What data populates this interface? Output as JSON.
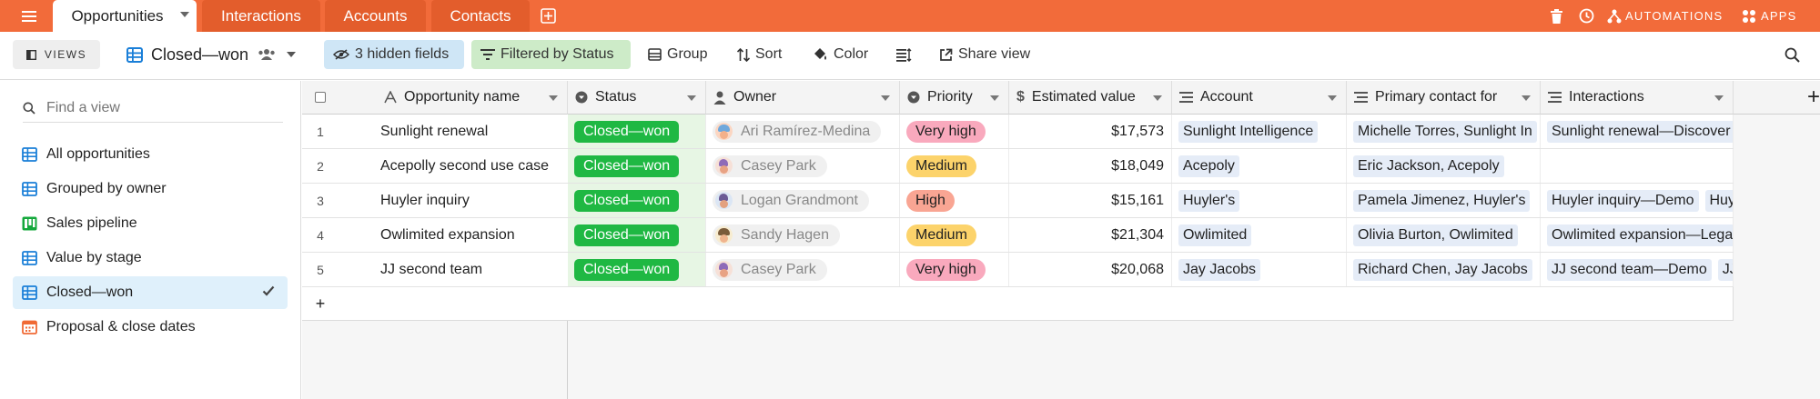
{
  "tabs": [
    {
      "label": "Opportunities",
      "active": true
    },
    {
      "label": "Interactions",
      "active": false
    },
    {
      "label": "Accounts",
      "active": false
    },
    {
      "label": "Contacts",
      "active": false
    }
  ],
  "top_right": {
    "automations": "AUTOMATIONS",
    "apps": "APPS"
  },
  "toolbar": {
    "views_label": "VIEWS",
    "view_name": "Closed—won",
    "hidden_fields": "3 hidden fields",
    "filtered": "Filtered by Status",
    "group": "Group",
    "sort": "Sort",
    "color": "Color",
    "share": "Share view"
  },
  "sidebar": {
    "search_placeholder": "Find a view",
    "items": [
      {
        "label": "All opportunities",
        "icon": "grid-view-icon"
      },
      {
        "label": "Grouped by owner",
        "icon": "grid-view-icon"
      },
      {
        "label": "Sales pipeline",
        "icon": "kanban-view-icon"
      },
      {
        "label": "Value by stage",
        "icon": "grid-view-icon"
      },
      {
        "label": "Closed—won",
        "icon": "grid-view-icon",
        "selected": true
      },
      {
        "label": "Proposal & close dates",
        "icon": "calendar-view-icon"
      }
    ]
  },
  "columns": {
    "name": "Opportunity name",
    "status": "Status",
    "owner": "Owner",
    "priority": "Priority",
    "value": "Estimated value",
    "account": "Account",
    "contact": "Primary contact for",
    "interactions": "Interactions"
  },
  "rows": [
    {
      "num": "1",
      "name": "Sunlight renewal",
      "status": "Closed—won",
      "owner": "Ari Ramírez-Medina",
      "priority": "Very high",
      "value": "$17,573",
      "account": "Sunlight Intelligence",
      "contact": "Michelle Torres, Sunlight In",
      "interactions": [
        "Sunlight renewal—Discover"
      ]
    },
    {
      "num": "2",
      "name": "Acepolly second use case",
      "status": "Closed—won",
      "owner": "Casey Park",
      "priority": "Medium",
      "value": "$18,049",
      "account": "Acepoly",
      "contact": "Eric Jackson, Acepoly",
      "interactions": []
    },
    {
      "num": "3",
      "name": "Huyler inquiry",
      "status": "Closed—won",
      "owner": "Logan Grandmont",
      "priority": "High",
      "value": "$15,161",
      "account": "Huyler's",
      "contact": "Pamela Jimenez, Huyler's",
      "interactions": [
        "Huyler inquiry—Demo",
        "Huy"
      ]
    },
    {
      "num": "4",
      "name": "Owlimited expansion",
      "status": "Closed—won",
      "owner": "Sandy Hagen",
      "priority": "Medium",
      "value": "$21,304",
      "account": "Owlimited",
      "contact": "Olivia Burton, Owlimited",
      "interactions": [
        "Owlimited expansion—Lega"
      ]
    },
    {
      "num": "5",
      "name": "JJ second team",
      "status": "Closed—won",
      "owner": "Casey Park",
      "priority": "Very high",
      "value": "$20,068",
      "account": "Jay Jacobs",
      "contact": "Richard Chen, Jay Jacobs",
      "interactions": [
        "JJ second team—Demo",
        "JJ"
      ]
    }
  ],
  "add_row": "+",
  "add_column": "+"
}
